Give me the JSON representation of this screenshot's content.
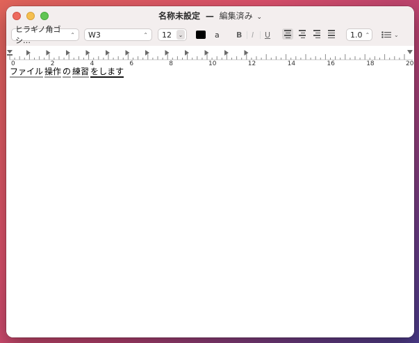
{
  "window": {
    "title_name": "名称未設定",
    "title_dash": "—",
    "title_status": "編集済み",
    "title_chevron": "⌄"
  },
  "toolbar": {
    "font_family": "ヒラギノ角ゴシ…",
    "font_style": "W3",
    "font_size": "12",
    "text_color": "#000000",
    "background_color_glyph": "a",
    "bold_label": "B",
    "italic_label": "I",
    "underline_label": "U",
    "alignment": "left",
    "line_spacing": "1.0",
    "popup_chevron": "⌃⌄",
    "stepper_chevron": "⌄",
    "list_chevron": "⌄"
  },
  "ruler": {
    "labels": [
      "0",
      "2",
      "4",
      "6",
      "8",
      "10",
      "12",
      "14",
      "16",
      "18",
      "20"
    ]
  },
  "document": {
    "segments": [
      "ファイル",
      "操作",
      "の",
      "練習",
      "をします"
    ]
  },
  "colors": {
    "title_bar": "#f3eeee",
    "close_button": "#ed6a5e",
    "minimize_button": "#f5bf4f",
    "zoom_button": "#61c554"
  }
}
